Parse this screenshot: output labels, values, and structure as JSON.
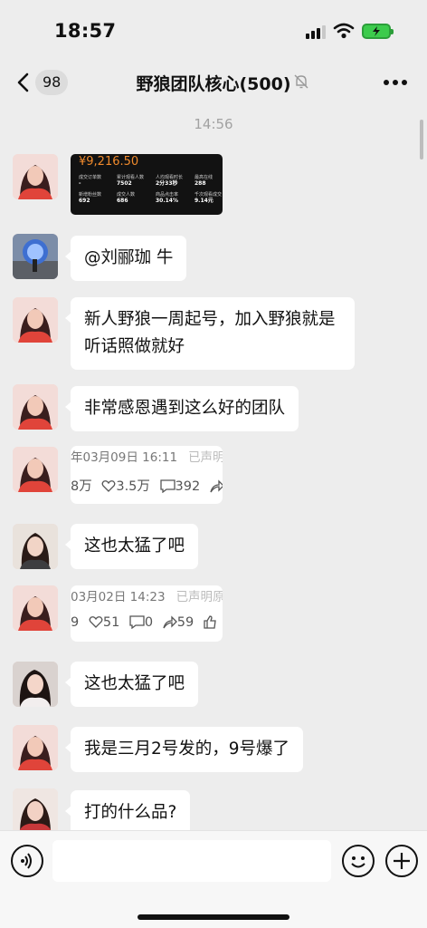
{
  "status_bar": {
    "time": "18:57"
  },
  "header": {
    "back_count": "98",
    "title": "野狼团队核心(500)"
  },
  "timestamp": "14:56",
  "messages": [
    {
      "type": "stats-card",
      "amount": "¥9,216.50",
      "stats": [
        {
          "label": "成交订单数",
          "value": "-"
        },
        {
          "label": "累计观看人数",
          "value": "7502"
        },
        {
          "label": "人均观看时长",
          "value": "2分33秒"
        },
        {
          "label": "最高在线",
          "value": "288"
        },
        {
          "label": "新增粉丝数",
          "value": "692"
        },
        {
          "label": "成交人数",
          "value": "686"
        },
        {
          "label": "商品点击率",
          "value": "30.14%"
        },
        {
          "label": "千次观看成交",
          "value": "9.14元"
        }
      ]
    },
    {
      "text": "@刘郦珈 牛"
    },
    {
      "text": "新人野狼一周起号，加入野狼就是听话照做就好"
    },
    {
      "text": "非常感恩遇到这么好的团队"
    },
    {
      "type": "post-clip",
      "date": "年03月09日 16:11",
      "tag": "已声明原",
      "views": "8万",
      "likes": "3.5万",
      "comments": "392"
    },
    {
      "text": "这也太猛了吧"
    },
    {
      "type": "post-clip",
      "date": "03月02日 14:23",
      "tag": "已声明原",
      "views": "9",
      "likes": "51",
      "comments": "0",
      "shares": "59"
    },
    {
      "text": "这也太猛了吧"
    },
    {
      "text": "我是三月2号发的，9号爆了"
    },
    {
      "text": "打的什么品?"
    }
  ],
  "colors": {
    "background": "#ededed",
    "bubble": "#ffffff",
    "money": "#f08a2c",
    "battery": "#3ccb4c"
  },
  "icons": [
    "back-arrow-icon",
    "mute-bell-icon",
    "more-dots-icon",
    "voice-icon",
    "emoji-icon",
    "plus-icon",
    "heart-icon",
    "comment-icon",
    "share-icon",
    "like-icon"
  ]
}
